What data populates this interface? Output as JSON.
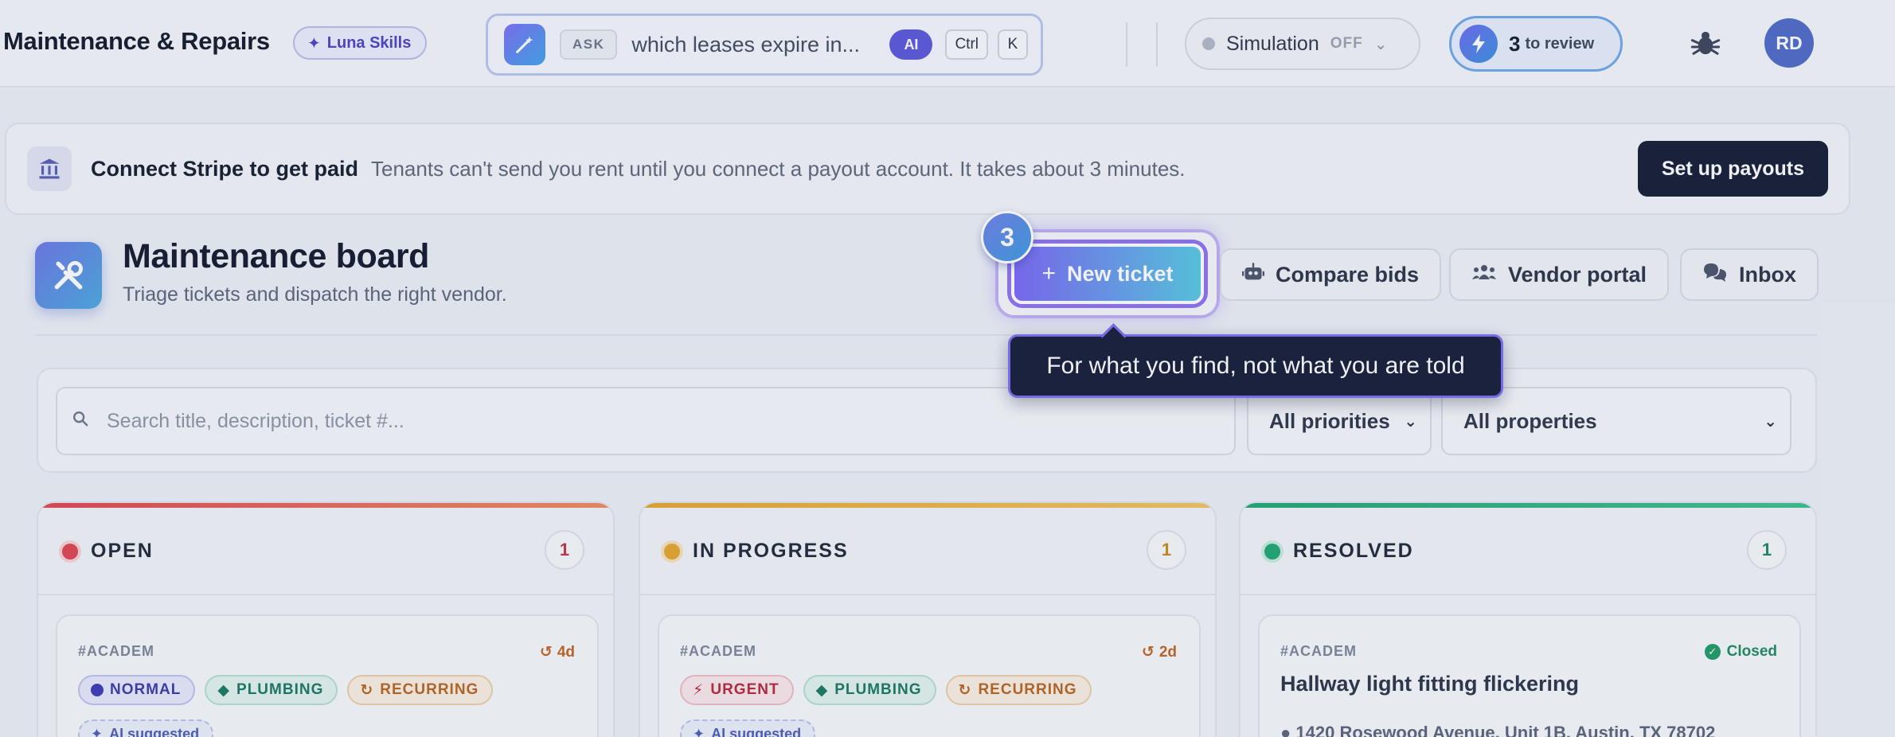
{
  "header": {
    "app_title": "Maintenance & Repairs",
    "skills_chip": "Luna Skills",
    "ask": {
      "tag": "ASK",
      "query": "which leases expire in...",
      "ai_pill": "AI",
      "shortcut_ctrl": "Ctrl",
      "shortcut_key": "K"
    },
    "simulation": {
      "label": "Simulation",
      "state": "OFF"
    },
    "review": {
      "count": "3",
      "label": "to review"
    },
    "avatar_initials": "RD",
    "icons": {
      "skills": "magic-wand-icon",
      "ask": "magic-wand-icon",
      "review": "lightning-icon",
      "debug": "bug-icon"
    }
  },
  "banner": {
    "title": "Connect Stripe to get paid",
    "description": "Tenants can't send you rent until you connect a payout account. It takes about 3 minutes.",
    "action": "Set up payouts",
    "icon": "bank-icon"
  },
  "page": {
    "title": "Maintenance board",
    "subtitle": "Triage tickets and dispatch the right vendor.",
    "actions": {
      "new_ticket": "New ticket",
      "compare_bids": "Compare bids",
      "vendor_portal": "Vendor portal",
      "inbox": "Inbox"
    }
  },
  "walkthrough": {
    "step": "3",
    "tooltip": "For what you find, not what you are told"
  },
  "filters": {
    "search_placeholder": "Search title, description, ticket #...",
    "priority": "All priorities",
    "property": "All properties"
  },
  "columns": [
    {
      "name": "OPEN",
      "count": "1",
      "color": "#e0434f",
      "card": {
        "id": "#ACADEM",
        "age": "4d",
        "tags": [
          "NORMAL",
          "PLUMBING",
          "RECURRING"
        ],
        "ai": "AI suggested"
      }
    },
    {
      "name": "IN PROGRESS",
      "count": "1",
      "color": "#e7a52a",
      "card": {
        "id": "#ACADEM",
        "age": "2d",
        "tags": [
          "URGENT",
          "PLUMBING",
          "RECURRING"
        ],
        "ai": "AI suggested"
      }
    },
    {
      "name": "RESOLVED",
      "count": "1",
      "color": "#1ea672",
      "card": {
        "id": "#ACADEM",
        "status": "Closed",
        "title": "Hallway light fitting flickering",
        "address": "1420 Rosewood Avenue, Unit 1B, Austin, TX 78702"
      }
    }
  ]
}
